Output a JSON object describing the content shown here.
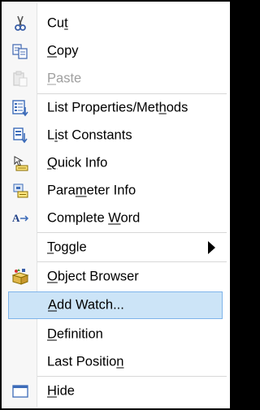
{
  "menu": {
    "items": [
      {
        "pre": "Cu",
        "acc": "t",
        "post": "",
        "icon": "scissors-icon",
        "disabled": false
      },
      {
        "pre": "",
        "acc": "C",
        "post": "opy",
        "icon": "copy-icon",
        "disabled": false
      },
      {
        "pre": "",
        "acc": "P",
        "post": "aste",
        "icon": "paste-icon",
        "disabled": true
      },
      {
        "pre": "List Properties/Met",
        "acc": "h",
        "post": "ods",
        "icon": "list-properties-icon",
        "disabled": false
      },
      {
        "pre": "L",
        "acc": "i",
        "post": "st Constants",
        "icon": "list-constants-icon",
        "disabled": false
      },
      {
        "pre": "",
        "acc": "Q",
        "post": "uick Info",
        "icon": "quick-info-icon",
        "disabled": false
      },
      {
        "pre": "Para",
        "acc": "m",
        "post": "eter Info",
        "icon": "parameter-info-icon",
        "disabled": false
      },
      {
        "pre": "Complete ",
        "acc": "W",
        "post": "ord",
        "icon": "complete-word-icon",
        "disabled": false
      },
      {
        "pre": "",
        "acc": "T",
        "post": "oggle",
        "icon": "",
        "disabled": false,
        "submenu": true
      },
      {
        "pre": "",
        "acc": "O",
        "post": "bject Browser",
        "icon": "object-browser-icon",
        "disabled": false
      },
      {
        "pre": "",
        "acc": "A",
        "post": "dd Watch...",
        "icon": "",
        "disabled": false,
        "highlighted": true
      },
      {
        "pre": "",
        "acc": "D",
        "post": "efinition",
        "icon": "",
        "disabled": false
      },
      {
        "pre": "Last Positio",
        "acc": "n",
        "post": "",
        "icon": "",
        "disabled": false
      },
      {
        "pre": "",
        "acc": "H",
        "post": "ide",
        "icon": "hide-window-icon",
        "disabled": false
      }
    ]
  },
  "colors": {
    "highlight_bg": "#cce4f7",
    "highlight_border": "#7eb4ea",
    "disabled_text": "#a0a0a0"
  }
}
